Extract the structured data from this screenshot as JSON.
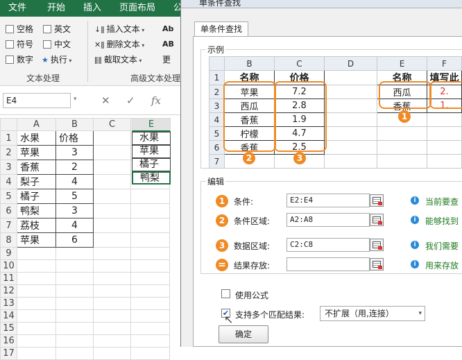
{
  "ribbon": {
    "tabs": [
      "文件",
      "开始",
      "插入",
      "页面布局",
      "公"
    ],
    "text_group": {
      "items": [
        "空格",
        "英文",
        "符号",
        "中文",
        "数字",
        "执行"
      ],
      "label": "文本处理"
    },
    "adv_group": {
      "items": [
        "插入文本",
        "删除文本",
        "截取文本"
      ],
      "extra": [
        "Ab",
        "AB",
        "更"
      ],
      "label": "高级文本处理"
    }
  },
  "formula_bar": {
    "name_box": "E4",
    "cancel": "✕",
    "enter": "✓",
    "fx": "fx"
  },
  "sheet": {
    "col_headers": [
      "A",
      "B",
      "C",
      "D",
      "E"
    ],
    "rows": [
      {
        "n": "1",
        "a": "水果",
        "b": "价格",
        "e": "水果"
      },
      {
        "n": "2",
        "a": "苹果",
        "b": "3",
        "e": "苹果"
      },
      {
        "n": "3",
        "a": "香蕉",
        "b": "2",
        "e": "橘子"
      },
      {
        "n": "4",
        "a": "梨子",
        "b": "4",
        "e": "鸭梨"
      },
      {
        "n": "5",
        "a": "橘子",
        "b": "5",
        "e": ""
      },
      {
        "n": "6",
        "a": "鸭梨",
        "b": "3",
        "e": ""
      },
      {
        "n": "7",
        "a": "荔枝",
        "b": "4",
        "e": ""
      },
      {
        "n": "8",
        "a": "苹果",
        "b": "6",
        "e": ""
      },
      {
        "n": "9",
        "a": "",
        "b": "",
        "e": ""
      },
      {
        "n": "10",
        "a": "",
        "b": "",
        "e": ""
      },
      {
        "n": "11",
        "a": "",
        "b": "",
        "e": ""
      },
      {
        "n": "12",
        "a": "",
        "b": "",
        "e": ""
      },
      {
        "n": "13",
        "a": "",
        "b": "",
        "e": ""
      },
      {
        "n": "14",
        "a": "",
        "b": "",
        "e": ""
      },
      {
        "n": "15",
        "a": "",
        "b": "",
        "e": ""
      },
      {
        "n": "16",
        "a": "",
        "b": "",
        "e": ""
      },
      {
        "n": "17",
        "a": "",
        "b": "",
        "e": ""
      }
    ]
  },
  "dialog": {
    "title": "单条件查找",
    "tab": "单条件查找",
    "example": {
      "legend": "示例",
      "cols": [
        "B",
        "C",
        "D",
        "E",
        "F"
      ],
      "rows": [
        {
          "n": "1",
          "b": "名称",
          "c": "价格",
          "e": "名称",
          "f": "填写此"
        },
        {
          "n": "2",
          "b": "苹果",
          "c": "7.2",
          "e": "西瓜",
          "f": "2."
        },
        {
          "n": "3",
          "b": "西瓜",
          "c": "2.8",
          "e": "香蕉",
          "f": "1."
        },
        {
          "n": "4",
          "b": "香蕉",
          "c": "1.9",
          "e": "",
          "f": ""
        },
        {
          "n": "5",
          "b": "柠檬",
          "c": "4.7",
          "e": "",
          "f": ""
        },
        {
          "n": "6",
          "b": "香蕉",
          "c": "2.5",
          "e": "",
          "f": ""
        },
        {
          "n": "7",
          "b": "",
          "c": "",
          "e": "",
          "f": ""
        }
      ],
      "badges": [
        "1",
        "2",
        "3"
      ]
    },
    "edit": {
      "legend": "编辑",
      "fields": [
        {
          "badge": "1",
          "label": "条件:",
          "value": "E2:E4",
          "hint": "当前要查"
        },
        {
          "badge": "2",
          "label": "条件区域:",
          "value": "A2:A8",
          "hint": "能够找到"
        },
        {
          "badge": "3",
          "label": "数据区域:",
          "value": "C2:C8",
          "hint": "我们需要"
        },
        {
          "badge": "=",
          "label": "结果存放:",
          "value": "",
          "hint": "用来存放"
        }
      ]
    },
    "use_formula": "使用公式",
    "multi_match": "支持多个匹配结果:",
    "mode_select": "不扩展（用,连接）",
    "ok": "确定"
  },
  "colors": {
    "accent": "#217346",
    "ring": "#f08a24",
    "hint": "#1f7a1f"
  }
}
